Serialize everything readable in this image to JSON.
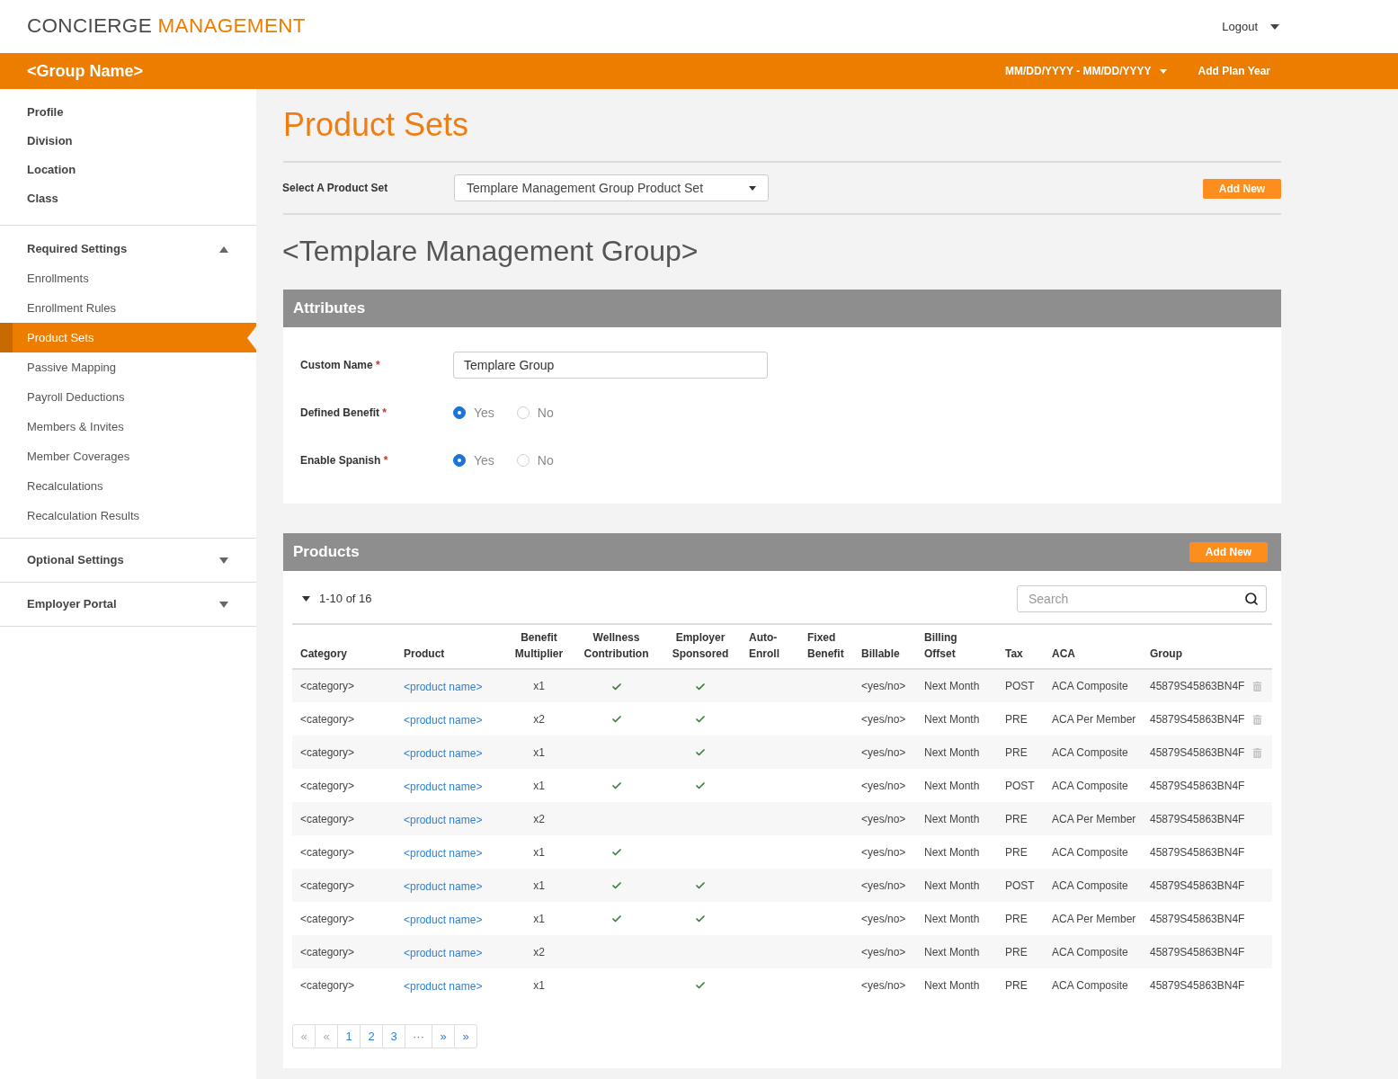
{
  "header": {
    "app_title": {
      "primary": "CONCIERGE",
      "accent": "MANAGEMENT"
    },
    "user_menu": {
      "label": "Logout"
    }
  },
  "group_bar": {
    "group_name": "<Group Name>",
    "date_range": "MM/DD/YYYY - MM/DD/YYYY",
    "add_plan_year": "Add Plan Year"
  },
  "sidebar": {
    "items": [
      {
        "label": "Profile",
        "selected": false
      },
      {
        "label": "Division",
        "selected": false
      },
      {
        "label": "Location",
        "selected": false
      },
      {
        "label": "Class",
        "selected": false
      }
    ],
    "sections": [
      {
        "title": "Required Settings",
        "expanded": true,
        "items": [
          {
            "label": "Enrollments",
            "selected": false
          },
          {
            "label": "Enrollment Rules",
            "selected": false
          },
          {
            "label": "Product Sets",
            "selected": true
          },
          {
            "label": "Passive Mapping",
            "selected": false
          },
          {
            "label": "Payroll Deductions",
            "selected": false
          },
          {
            "label": "Members & Invites",
            "selected": false
          },
          {
            "label": "Member Coverages",
            "selected": false
          },
          {
            "label": "Recalculations",
            "selected": false
          },
          {
            "label": "Recalculation Results",
            "selected": false
          }
        ]
      },
      {
        "title": "Optional Settings",
        "expanded": false
      },
      {
        "title": "Employer Portal",
        "expanded": false
      }
    ]
  },
  "page": {
    "title": "Product Sets",
    "product_set_select": {
      "label": "Select A Product Set",
      "value": "Templare Management Group Product Set"
    },
    "add_new": "Add New",
    "group_heading": "<Templare Management Group>"
  },
  "attributes": {
    "title": "Attributes",
    "fields": [
      {
        "kind": "text",
        "label": "Custom Name",
        "required_mark": "*",
        "value": "Templare Group"
      },
      {
        "kind": "radio",
        "label": "Defined Benefit",
        "required_mark": "*",
        "options": [
          {
            "label": "Yes",
            "selected": true
          },
          {
            "label": "No",
            "selected": false
          }
        ]
      },
      {
        "kind": "radio",
        "label": "Enable Spanish",
        "required_mark": "*",
        "options": [
          {
            "label": "Yes",
            "selected": true
          },
          {
            "label": "No",
            "selected": false
          }
        ]
      }
    ]
  },
  "products": {
    "title": "Products",
    "add_new": "Add New",
    "range": "1-10 of 16",
    "search": {
      "placeholder": "Search"
    },
    "table": {
      "columns": [
        {
          "lines": [
            "Category"
          ]
        },
        {
          "lines": [
            "Product"
          ]
        },
        {
          "lines": [
            "Benefit",
            "Multiplier"
          ]
        },
        {
          "lines": [
            "Wellness",
            "Contribution"
          ]
        },
        {
          "lines": [
            "Employer",
            "Sponsored"
          ]
        },
        {
          "lines": [
            "Auto-",
            "Enroll"
          ]
        },
        {
          "lines": [
            "Fixed",
            "Benefit"
          ]
        },
        {
          "lines": [
            "Billable"
          ]
        },
        {
          "lines": [
            "Billing",
            "Offset"
          ]
        },
        {
          "lines": [
            "Tax"
          ]
        },
        {
          "lines": [
            "ACA"
          ]
        },
        {
          "lines": [
            "Group"
          ]
        }
      ],
      "rows": [
        {
          "category": "<category>",
          "product": "<product name>",
          "multiplier": "x1",
          "wellness_contribution": true,
          "employer_sponsored": true,
          "billable": "<yes/no>",
          "billing_offset": "Next Month",
          "tax": "POST",
          "aca": "ACA Composite",
          "group": "45879S45863BN4F",
          "deletable": true
        },
        {
          "category": "<category>",
          "product": "<product name>",
          "multiplier": "x2",
          "wellness_contribution": true,
          "employer_sponsored": true,
          "billable": "<yes/no>",
          "billing_offset": "Next Month",
          "tax": "PRE",
          "aca": "ACA Per Member",
          "group": "45879S45863BN4F",
          "deletable": true
        },
        {
          "category": "<category>",
          "product": "<product name>",
          "multiplier": "x1",
          "wellness_contribution": false,
          "employer_sponsored": true,
          "billable": "<yes/no>",
          "billing_offset": "Next Month",
          "tax": "PRE",
          "aca": "ACA Composite",
          "group": "45879S45863BN4F",
          "deletable": true
        },
        {
          "category": "<category>",
          "product": "<product name>",
          "multiplier": "x1",
          "wellness_contribution": true,
          "employer_sponsored": true,
          "billable": "<yes/no>",
          "billing_offset": "Next Month",
          "tax": "POST",
          "aca": "ACA Composite",
          "group": "45879S45863BN4F",
          "deletable": false
        },
        {
          "category": "<category>",
          "product": "<product name>",
          "multiplier": "x2",
          "wellness_contribution": false,
          "employer_sponsored": false,
          "billable": "<yes/no>",
          "billing_offset": "Next Month",
          "tax": "PRE",
          "aca": "ACA Per Member",
          "group": "45879S45863BN4F",
          "deletable": false
        },
        {
          "category": "<category>",
          "product": "<product name>",
          "multiplier": "x1",
          "wellness_contribution": true,
          "employer_sponsored": false,
          "billable": "<yes/no>",
          "billing_offset": "Next Month",
          "tax": "PRE",
          "aca": "ACA Composite",
          "group": "45879S45863BN4F",
          "deletable": false
        },
        {
          "category": "<category>",
          "product": "<product name>",
          "multiplier": "x1",
          "wellness_contribution": true,
          "employer_sponsored": true,
          "billable": "<yes/no>",
          "billing_offset": "Next Month",
          "tax": "POST",
          "aca": "ACA Composite",
          "group": "45879S45863BN4F",
          "deletable": false
        },
        {
          "category": "<category>",
          "product": "<product name>",
          "multiplier": "x1",
          "wellness_contribution": true,
          "employer_sponsored": true,
          "billable": "<yes/no>",
          "billing_offset": "Next Month",
          "tax": "PRE",
          "aca": "ACA Per Member",
          "group": "45879S45863BN4F",
          "deletable": false
        },
        {
          "category": "<category>",
          "product": "<product name>",
          "multiplier": "x2",
          "wellness_contribution": false,
          "employer_sponsored": false,
          "billable": "<yes/no>",
          "billing_offset": "Next Month",
          "tax": "PRE",
          "aca": "ACA Composite",
          "group": "45879S45863BN4F",
          "deletable": false
        },
        {
          "category": "<category>",
          "product": "<product name>",
          "multiplier": "x1",
          "wellness_contribution": false,
          "employer_sponsored": true,
          "billable": "<yes/no>",
          "billing_offset": "Next Month",
          "tax": "PRE",
          "aca": "ACA Composite",
          "group": "45879S45863BN4F",
          "deletable": false
        }
      ]
    },
    "pagination": [
      {
        "label": "«",
        "disabled": true
      },
      {
        "label": "«",
        "disabled": true
      },
      {
        "label": "1",
        "disabled": false
      },
      {
        "label": "2",
        "disabled": false
      },
      {
        "label": "3",
        "disabled": false
      },
      {
        "label": "···",
        "disabled": false
      },
      {
        "label": "»",
        "disabled": false
      },
      {
        "label": "»",
        "disabled": false
      }
    ]
  }
}
